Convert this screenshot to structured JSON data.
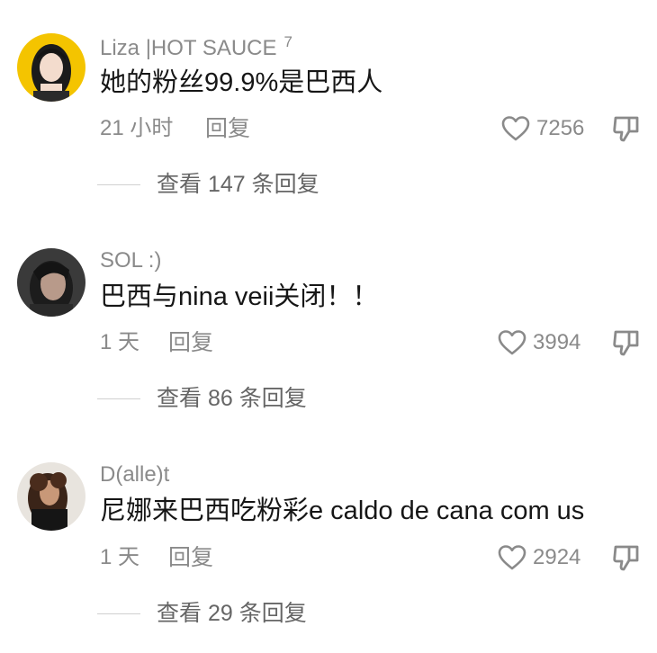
{
  "comments": [
    {
      "username": "Liza |HOT SAUCE",
      "badge": "7",
      "text": "她的粉丝99.9%是巴西人",
      "time": "21 小时",
      "reply_label": "回复",
      "likes": "7256",
      "view_replies": "查看 147 条回复"
    },
    {
      "username": "SOL :)",
      "badge": "",
      "text": "巴西与nina veii关闭！！",
      "time": "1 天",
      "reply_label": "回复",
      "likes": "3994",
      "view_replies": "查看 86 条回复"
    },
    {
      "username": "D(alle)t",
      "badge": "",
      "text": "尼娜来巴西吃粉彩e caldo de cana com us",
      "time": "1 天",
      "reply_label": "回复",
      "likes": "2924",
      "view_replies": "查看 29 条回复"
    }
  ],
  "icons": {
    "like": "heart-outline-icon",
    "dislike": "thumbs-down-icon"
  },
  "colors": {
    "text_primary": "#161616",
    "text_secondary": "#8a8a8a",
    "avatar1_bg": "#f4c400",
    "avatar2_bg": "#3a3a3a",
    "avatar3_bg": "#e8e4de"
  }
}
